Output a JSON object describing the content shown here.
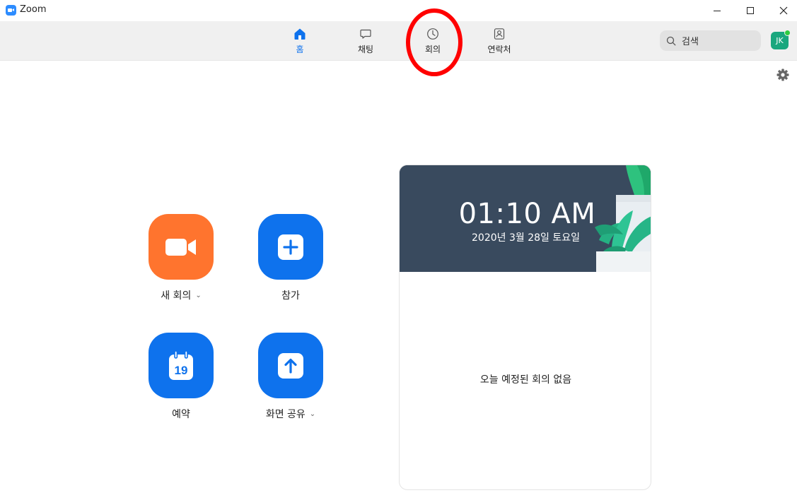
{
  "window": {
    "title": "Zoom"
  },
  "nav": {
    "tabs": [
      {
        "label": "홈",
        "icon": "home-icon",
        "active": true
      },
      {
        "label": "채팅",
        "icon": "chat-icon",
        "active": false
      },
      {
        "label": "회의",
        "icon": "clock-icon",
        "active": false
      },
      {
        "label": "연락처",
        "icon": "contacts-icon",
        "active": false
      }
    ]
  },
  "search": {
    "placeholder": "검색"
  },
  "user": {
    "initials": "JK",
    "status": "online"
  },
  "actions": {
    "new_meeting": {
      "label": "새 회의",
      "icon": "video-camera-icon",
      "color": "#FF742E"
    },
    "join": {
      "label": "참가",
      "icon": "plus-icon",
      "color": "#0E72ED"
    },
    "schedule": {
      "label": "예약",
      "icon": "calendar-icon",
      "color": "#0E72ED",
      "calendar_day": "19"
    },
    "share_screen": {
      "label": "화면 공유",
      "icon": "upload-arrow-icon",
      "color": "#0E72ED"
    }
  },
  "calendar_card": {
    "time": "01:10 AM",
    "date": "2020년 3월 28일 토요일",
    "empty_message": "오늘 예정된 회의 없음"
  },
  "colors": {
    "accent": "#0E72ED",
    "annotation": "#FF0000",
    "avatar": "#1AA77E"
  }
}
